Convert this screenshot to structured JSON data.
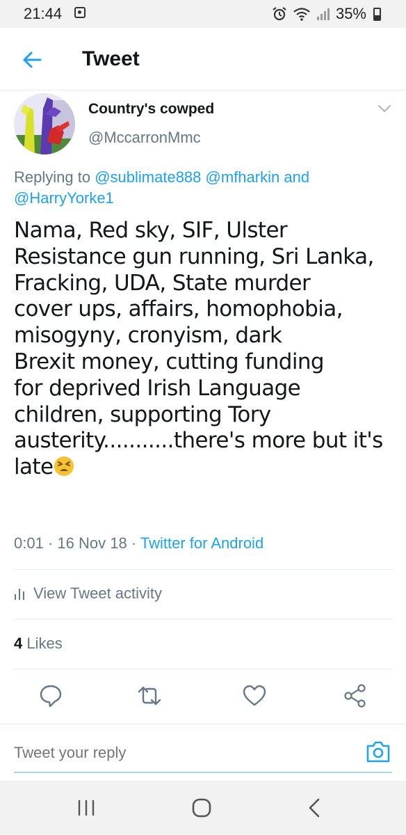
{
  "status_bar": {
    "time": "21:44",
    "battery": "35%",
    "icons": [
      "notification-icon",
      "alarm-icon",
      "wifi-icon",
      "signal-icon",
      "battery-icon"
    ]
  },
  "header": {
    "title": "Tweet",
    "back_icon": "back-arrow-icon"
  },
  "tweet": {
    "author": {
      "display_name": "Country's cowped",
      "handle": "@MccarronMmc"
    },
    "replying_prefix": "Replying to",
    "replying_to": [
      "@sublimate888",
      "@mfharkin",
      "@HarryYorke1"
    ],
    "replying_joiner": "and",
    "text_lines": [
      "Nama, Red sky, SIF, Ulster",
      "Resistance gun running, Sri Lanka,",
      "Fracking, UDA, State murder",
      "cover ups, affairs, homophobia,",
      "misogyny, cronyism, dark",
      "Brexit money, cutting funding",
      "for deprived Irish Language",
      "children, supporting Tory",
      "austerity...........there's more but it's",
      "late"
    ],
    "emoji": "tired-face-emoji",
    "time": "0:01",
    "date": "16 Nov 18",
    "separator": "·",
    "source": "Twitter for Android",
    "activity_label": "View Tweet activity",
    "likes_count": "4",
    "likes_label": "Likes"
  },
  "actions": [
    "reply-icon",
    "retweet-icon",
    "like-icon",
    "share-icon"
  ],
  "reply_bar": {
    "placeholder": "Tweet your reply"
  },
  "nav_bar": [
    "recent-apps-icon",
    "home-icon",
    "back-icon"
  ],
  "colors": {
    "accent": "#1da1f2",
    "secondary_text": "#657786",
    "primary_text": "#14171a",
    "divider": "#e6ecf0"
  }
}
